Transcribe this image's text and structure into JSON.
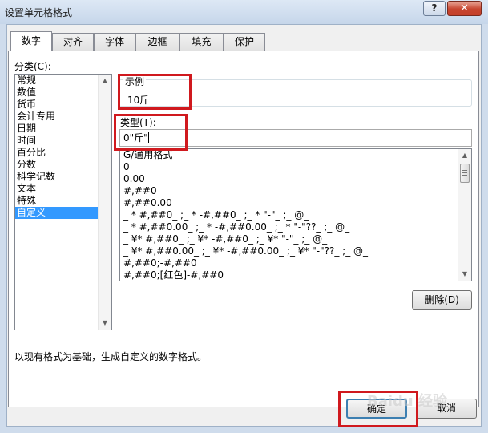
{
  "window": {
    "title": "设置单元格格式",
    "help_label": "?",
    "close_label": "✕"
  },
  "tabs": [
    {
      "label": "数字",
      "active": true
    },
    {
      "label": "对齐",
      "active": false
    },
    {
      "label": "字体",
      "active": false
    },
    {
      "label": "边框",
      "active": false
    },
    {
      "label": "填充",
      "active": false
    },
    {
      "label": "保护",
      "active": false
    }
  ],
  "category": {
    "label": "分类(C):",
    "items": [
      "常规",
      "数值",
      "货币",
      "会计专用",
      "日期",
      "时间",
      "百分比",
      "分数",
      "科学记数",
      "文本",
      "特殊",
      "自定义"
    ],
    "selected": "自定义"
  },
  "sample": {
    "label": "示例",
    "value": "10斤"
  },
  "type": {
    "label": "类型(T):",
    "value": "0\"斤\"",
    "formats": [
      "G/通用格式",
      "0",
      "0.00",
      "#,##0",
      "#,##0.00",
      "_ * #,##0_ ;_ * -#,##0_ ;_ * \"-\"_ ;_ @_",
      "_ * #,##0.00_ ;_ * -#,##0.00_ ;_ * \"-\"??_ ;_ @_",
      "_ ¥* #,##0_ ;_ ¥* -#,##0_ ;_ ¥* \"-\"_ ;_ @_",
      "_ ¥* #,##0.00_ ;_ ¥* -#,##0.00_ ;_ ¥* \"-\"??_ ;_ @_",
      "#,##0;-#,##0",
      "#,##0;[红色]-#,##0"
    ]
  },
  "buttons": {
    "delete": "删除(D)",
    "ok": "确定",
    "cancel": "取消"
  },
  "description": "以现有格式为基础，生成自定义的数字格式。",
  "watermark": "Baidu 经验",
  "colors": {
    "highlight_box": "#d0191e",
    "selection": "#3399ff"
  }
}
